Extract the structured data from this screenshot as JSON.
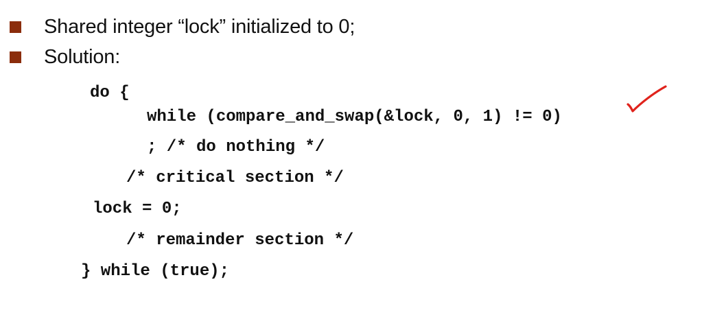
{
  "bullets": [
    {
      "text": "Shared integer  “lock”  initialized to 0;"
    },
    {
      "text": "Solution:"
    }
  ],
  "code": {
    "line1": "do {",
    "line2": "while (compare_and_swap(&lock, 0, 1) != 0)",
    "line3": "; /* do nothing */",
    "line4": "/* critical section */",
    "line5": "lock = 0;",
    "line6": "/* remainder section */",
    "line7": "} while (true);"
  },
  "colors": {
    "bullet": "#8b2d0c",
    "annotation": "#e0231c"
  },
  "annotation": {
    "icon": "checkmark-icon"
  }
}
